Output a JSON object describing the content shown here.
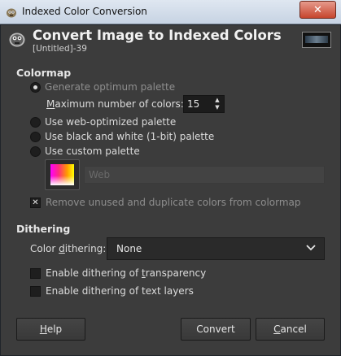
{
  "window": {
    "title": "Indexed Color Conversion",
    "close_glyph": "✕"
  },
  "header": {
    "title": "Convert Image to Indexed Colors",
    "subtitle": "[Untitled]-39"
  },
  "colormap": {
    "heading": "Colormap",
    "generate_optimum": "Generate optimum palette",
    "max_colors_prefix": "M",
    "max_colors_rest": "aximum number of colors:",
    "max_colors_value": "15",
    "web_optimized": "Use web-optimized palette",
    "black_white": "Use black and white (1-bit) palette",
    "custom_palette": "Use custom palette",
    "palette_name": "Web",
    "remove_unused": "Remove unused and duplicate colors from colormap",
    "selected_option": "generate_optimum"
  },
  "dithering": {
    "heading": "Dithering",
    "color_dithering_pre": "Color ",
    "color_dithering_u": "d",
    "color_dithering_post": "ithering:",
    "color_dithering_value": "None",
    "transparency_pre": "Enable dithering of ",
    "transparency_u": "t",
    "transparency_post": "ransparency",
    "text_layers": "Enable dithering of text layers"
  },
  "buttons": {
    "help_u": "H",
    "help_rest": "elp",
    "convert": "Convert",
    "cancel_u": "C",
    "cancel_rest": "ancel"
  },
  "icons": {
    "app": "gimp-icon",
    "header": "gimp-icon",
    "combo": "chevron-down-icon"
  }
}
